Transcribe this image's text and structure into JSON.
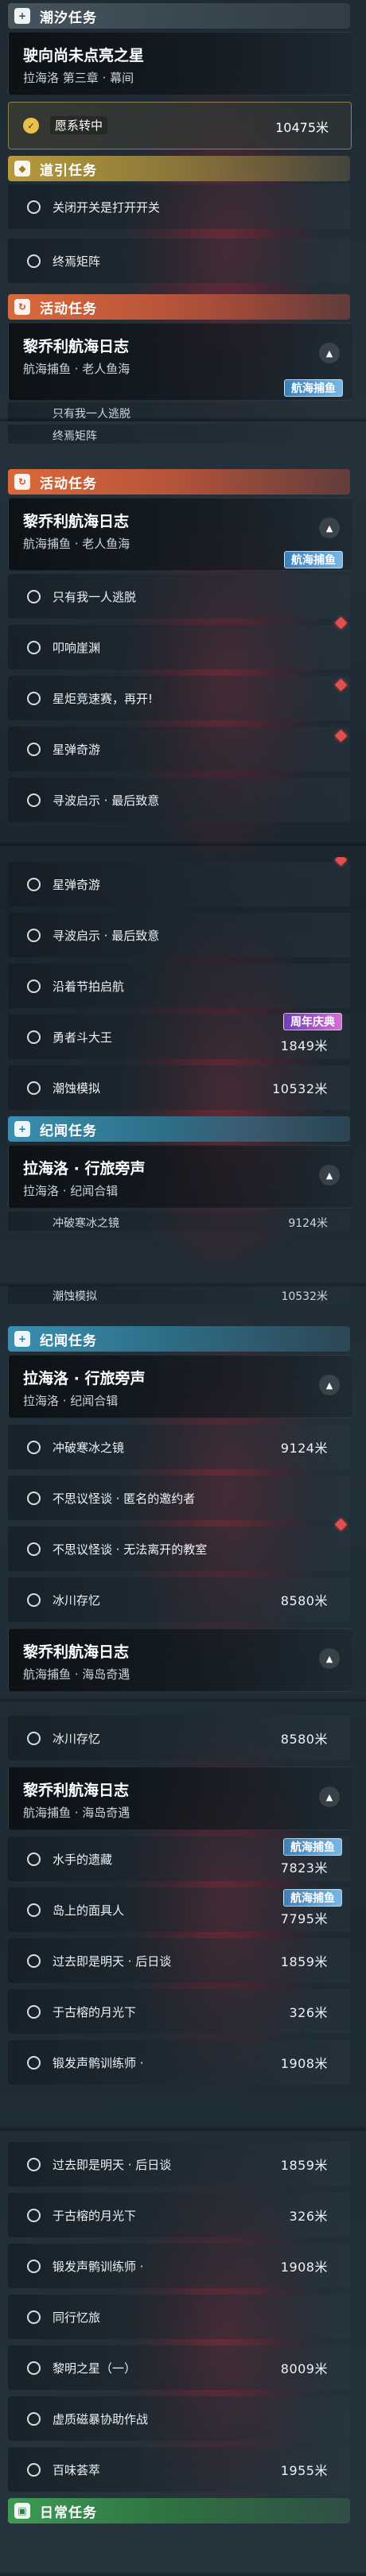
{
  "panel1": {
    "category": {
      "icon": "+",
      "label": "潮汐任务"
    },
    "card": {
      "title": "驶向尚未点亮之星",
      "subtitle": "拉海洛 第三章 · 幕间"
    },
    "tracking": {
      "icon": "✓",
      "label": "愿系转中",
      "distance": "10475米"
    },
    "guide_category": {
      "icon": "◆",
      "label": "道引任务"
    },
    "guide_rows": [
      {
        "name": "关闭开关是打开开关"
      },
      {
        "name": "终焉矩阵"
      }
    ],
    "activity_category": {
      "icon": "↻",
      "label": "活动任务"
    },
    "activity_card": {
      "title": "黎乔利航海日志",
      "subtitle": "航海捕鱼 · 老人鱼海",
      "tag": "航海捕鱼"
    },
    "cut_row": {
      "name": "只有我一人逃脱"
    }
  },
  "panel2": {
    "cut_row": {
      "name": "终焉矩阵"
    },
    "activity_category": {
      "icon": "↻",
      "label": "活动任务"
    },
    "card": {
      "title": "黎乔利航海日志",
      "subtitle": "航海捕鱼 · 老人鱼海",
      "tag": "航海捕鱼"
    },
    "rows": [
      {
        "name": "只有我一人逃脱"
      },
      {
        "name": "叩响崖渊"
      },
      {
        "name": "星炬竞速赛，再开!"
      },
      {
        "name": "星弹奇游"
      },
      {
        "name": "寻波启示 · 最后致意"
      }
    ]
  },
  "panel3": {
    "rows": [
      {
        "name": "星弹奇游"
      },
      {
        "name": "寻波启示 · 最后致意"
      },
      {
        "name": "沿着节拍启航"
      },
      {
        "name": "勇者斗大王",
        "distance": "1849米",
        "tag": "周年庆典"
      },
      {
        "name": "潮蚀模拟",
        "distance": "10532米"
      }
    ],
    "category": {
      "icon": "+",
      "label": "纪闻任务"
    },
    "card": {
      "title": "拉海洛 · 行旅旁声",
      "subtitle": "拉海洛 · 纪闻合辑"
    },
    "cut_rows": [
      {
        "name": "冲破寒冰之镜",
        "distance": "9124米"
      }
    ]
  },
  "panel4": {
    "cut_row": {
      "name": "潮蚀模拟",
      "distance": "10532米"
    },
    "category": {
      "icon": "+",
      "label": "纪闻任务"
    },
    "card": {
      "title": "拉海洛 · 行旅旁声",
      "subtitle": "拉海洛 · 纪闻合辑"
    },
    "rows": [
      {
        "name": "冲破寒冰之镜",
        "distance": "9124米"
      },
      {
        "name": "不思议怪谈 · 匿名的邀约者"
      },
      {
        "name": "不思议怪谈 · 无法离开的教室"
      },
      {
        "name": "冰川存忆",
        "distance": "8580米"
      }
    ],
    "card2": {
      "title": "黎乔利航海日志",
      "subtitle": "航海捕鱼 · 海岛奇遇"
    }
  },
  "panel5": {
    "rows_top": [
      {
        "name": "冰川存忆",
        "distance": "8580米"
      }
    ],
    "card": {
      "title": "黎乔利航海日志",
      "subtitle": "航海捕鱼 · 海岛奇遇"
    },
    "rows": [
      {
        "name": "水手的遗藏",
        "distance": "7823米",
        "tag": "航海捕鱼"
      },
      {
        "name": "岛上的面具人",
        "distance": "7795米",
        "tag": "航海捕鱼"
      },
      {
        "name": "过去即是明天 · 后日谈",
        "distance": "1859米"
      },
      {
        "name": "于古榕的月光下",
        "distance": "326米"
      },
      {
        "name": "锻发声鹘训练师 ·",
        "distance": "1908米"
      }
    ]
  },
  "panel6": {
    "rows": [
      {
        "name": "过去即是明天 · 后日谈",
        "distance": "1859米"
      },
      {
        "name": "于古榕的月光下",
        "distance": "326米"
      },
      {
        "name": "锻发声鹘训练师 ·",
        "distance": "1908米"
      },
      {
        "name": "同行忆旅"
      },
      {
        "name": "黎明之星（一）",
        "distance": "8009米"
      },
      {
        "name": "虚质磁暴协助作战"
      },
      {
        "name": "百味荟萃",
        "distance": "1955米"
      }
    ],
    "category": {
      "icon": "▣",
      "label": "日常任务"
    }
  }
}
